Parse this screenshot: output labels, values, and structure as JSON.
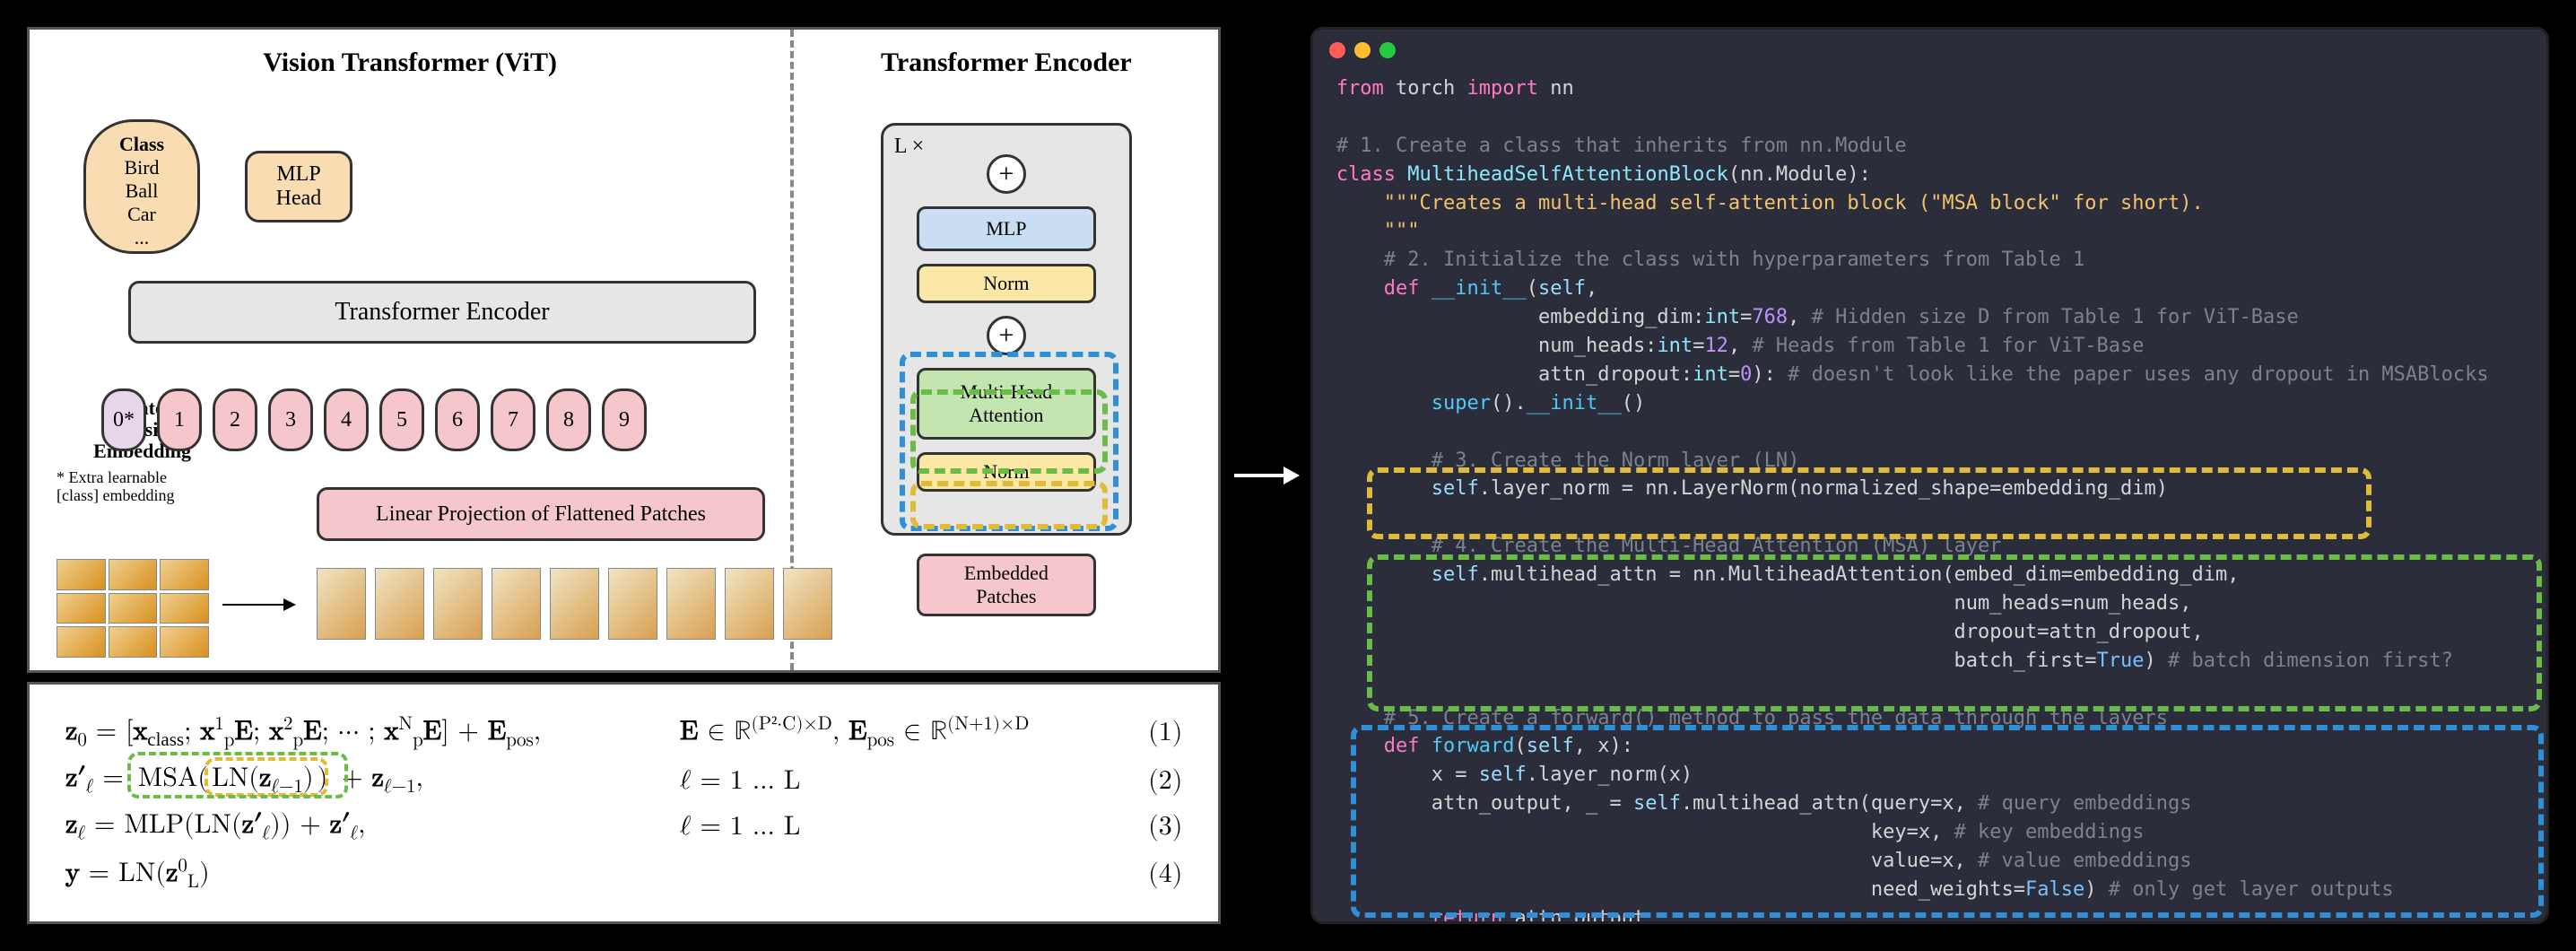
{
  "figure": {
    "vit_title": "Vision Transformer (ViT)",
    "enc_title": "Transformer Encoder",
    "class_header": "Class",
    "class_items": [
      "Bird",
      "Ball",
      "Car",
      "..."
    ],
    "mlp_head": "MLP\nHead",
    "transformer_encoder": "Transformer Encoder",
    "tokens": [
      "0*",
      "1",
      "2",
      "3",
      "4",
      "5",
      "6",
      "7",
      "8",
      "9"
    ],
    "linproj": "Linear Projection of Flattened Patches",
    "patch_pos_label": "Patch + Position\nEmbedding",
    "extra_note": "* Extra learnable\n[class] embedding",
    "lx": "L ×",
    "mlp_block": "MLP",
    "norm_block": "Norm",
    "mha_block": "Multi-Head\nAttention",
    "embedded_patches": "Embedded\nPatches",
    "plus": "+"
  },
  "equations": {
    "eq1_l": "z₀ = [x_class; x¹_p E; x²_p E; ⋯ ; xᴺ_p E] + E_pos,",
    "eq1_m": "E ∈ ℝ^(P²·C)×D, E_pos ∈ ℝ^(N+1)×D",
    "eq1_n": "(1)",
    "eq2_l": "z′_ℓ = MSA(LN(z_{ℓ−1})) + z_{ℓ−1},",
    "eq2_m": "ℓ = 1 … L",
    "eq2_n": "(2)",
    "eq3_l": "z_ℓ = MLP(LN(z′_ℓ)) + z′_ℓ,",
    "eq3_m": "ℓ = 1 … L",
    "eq3_n": "(3)",
    "eq4_l": "y = LN(z⁰_L)",
    "eq4_m": "",
    "eq4_n": "(4)"
  },
  "chart_data": {
    "type": "diagram",
    "vit_architecture": {
      "input": "image_patches_3x3",
      "sequence": [
        "Linear Projection of Flattened Patches",
        "Patch + Position Embedding (tokens 0*..9)",
        "Transformer Encoder",
        "MLP Head",
        "Class output"
      ],
      "num_tokens": 10,
      "token_labels": [
        "0*",
        "1",
        "2",
        "3",
        "4",
        "5",
        "6",
        "7",
        "8",
        "9"
      ]
    },
    "transformer_encoder_block": {
      "repeat": "L ×",
      "layers_bottom_to_top": [
        "Embedded Patches",
        "Norm",
        "Multi-Head Attention",
        "Residual Add",
        "Norm",
        "MLP",
        "Residual Add"
      ]
    },
    "equations": [
      {
        "id": 1,
        "text": "z0 = [x_class; x1_p E; x2_p E; …; xN_p E] + E_pos",
        "where": "E ∈ R^{(P^2·C)×D}, E_pos ∈ R^{(N+1)×D}"
      },
      {
        "id": 2,
        "text": "z'_ℓ = MSA(LN(z_{ℓ-1})) + z_{ℓ-1}",
        "where": "ℓ = 1…L"
      },
      {
        "id": 3,
        "text": "z_ℓ = MLP(LN(z'_ℓ)) + z'_ℓ",
        "where": "ℓ = 1…L"
      },
      {
        "id": 4,
        "text": "y = LN(z^0_L)"
      }
    ],
    "highlight_mapping": [
      {
        "color": "yellow",
        "equation_part": "LN(z_{ℓ-1})",
        "code_block": "self.layer_norm = nn.LayerNorm(...)"
      },
      {
        "color": "green",
        "equation_part": "MSA(·)",
        "code_block": "self.multihead_attn = nn.MultiheadAttention(...)"
      },
      {
        "color": "blue",
        "equation_part": "z'_ℓ (forward pass)",
        "code_block": "def forward(self, x): ..."
      }
    ]
  },
  "code": {
    "line01": "from torch import nn",
    "line02": "",
    "line03": "# 1. Create a class that inherits from nn.Module",
    "line04": "class MultiheadSelfAttentionBlock(nn.Module):",
    "line05": "    \"\"\"Creates a multi-head self-attention block (\"MSA block\" for short).",
    "line06": "    \"\"\"",
    "line07": "    # 2. Initialize the class with hyperparameters from Table 1",
    "line08": "    def __init__(self,",
    "line09": "                 embedding_dim:int=768, # Hidden size D from Table 1 for ViT-Base",
    "line10": "                 num_heads:int=12, # Heads from Table 1 for ViT-Base",
    "line11": "                 attn_dropout:int=0): # doesn't look like the paper uses any dropout in MSABlocks",
    "line12": "        super().__init__()",
    "line13": "",
    "line14": "        # 3. Create the Norm layer (LN)",
    "line15": "        self.layer_norm = nn.LayerNorm(normalized_shape=embedding_dim)",
    "line16": "",
    "line17": "        # 4. Create the Multi-Head Attention (MSA) layer",
    "line18": "        self.multihead_attn = nn.MultiheadAttention(embed_dim=embedding_dim,",
    "line19": "                                                    num_heads=num_heads,",
    "line20": "                                                    dropout=attn_dropout,",
    "line21": "                                                    batch_first=True) # batch dimension first?",
    "line22": "",
    "line23": "    # 5. Create a forward() method to pass the data through the layers",
    "line24": "    def forward(self, x):",
    "line25": "        x = self.layer_norm(x)",
    "line26": "        attn_output, _ = self.multihead_attn(query=x, # query embeddings",
    "line27": "                                             key=x, # key embeddings",
    "line28": "                                             value=x, # value embeddings",
    "line29": "                                             need_weights=False) # only get layer outputs",
    "line30": "        return attn_output"
  }
}
